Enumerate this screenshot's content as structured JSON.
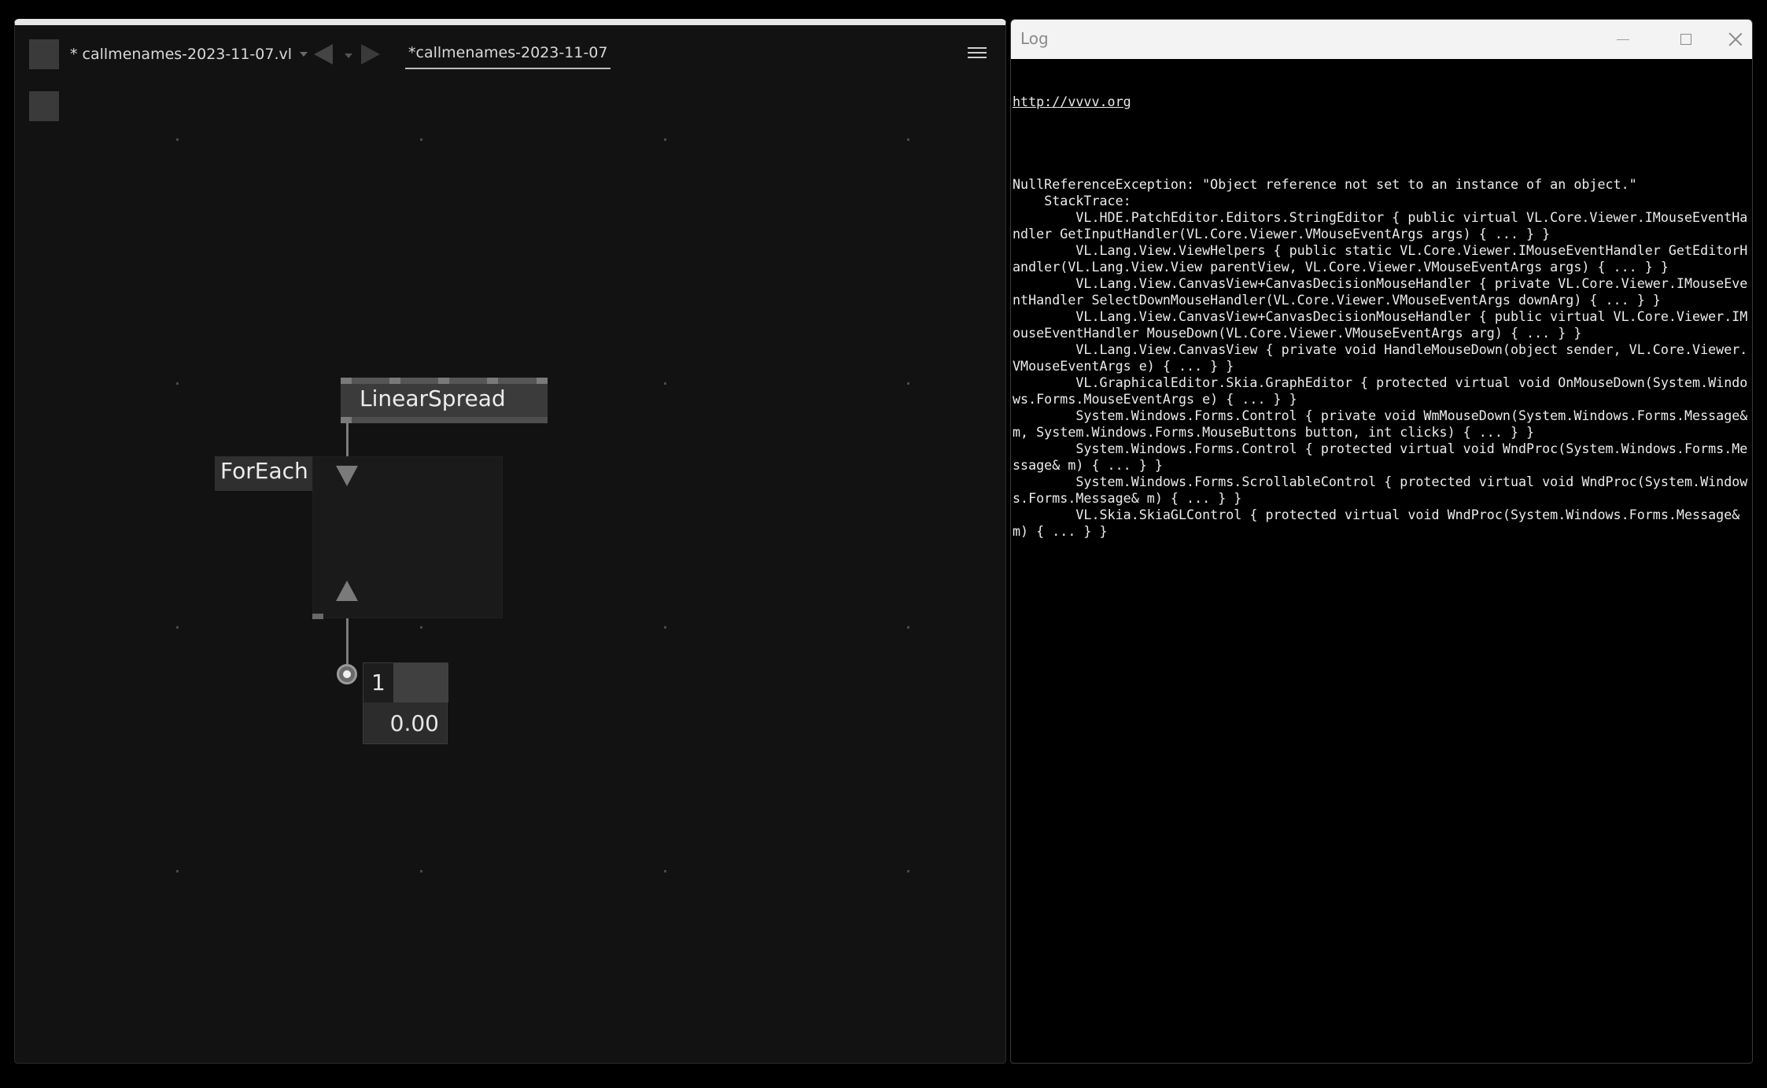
{
  "editor": {
    "document_dropdown": "* callmenames-2023-11-07.vl",
    "active_tab": "*callmenames-2023-11-07",
    "menu_icon": "hamburger-icon",
    "nodes": {
      "linearspread": "LinearSpread",
      "foreach": "ForEach",
      "iobox_count": "1",
      "iobox_value": "0.00"
    }
  },
  "log": {
    "title": "Log",
    "link": "http://vvvv.org",
    "text": "NullReferenceException: \"Object reference not set to an instance of an object.\"\n    StackTrace:\n        VL.HDE.PatchEditor.Editors.StringEditor { public virtual VL.Core.Viewer.IMouseEventHandler GetInputHandler(VL.Core.Viewer.VMouseEventArgs args) { ... } }\n        VL.Lang.View.ViewHelpers { public static VL.Core.Viewer.IMouseEventHandler GetEditorHandler(VL.Lang.View.View parentView, VL.Core.Viewer.VMouseEventArgs args) { ... } }\n        VL.Lang.View.CanvasView+CanvasDecisionMouseHandler { private VL.Core.Viewer.IMouseEventHandler SelectDownMouseHandler(VL.Core.Viewer.VMouseEventArgs downArg) { ... } }\n        VL.Lang.View.CanvasView+CanvasDecisionMouseHandler { public virtual VL.Core.Viewer.IMouseEventHandler MouseDown(VL.Core.Viewer.VMouseEventArgs arg) { ... } }\n        VL.Lang.View.CanvasView { private void HandleMouseDown(object sender, VL.Core.Viewer.VMouseEventArgs e) { ... } }\n        VL.GraphicalEditor.Skia.GraphEditor { protected virtual void OnMouseDown(System.Windows.Forms.MouseEventArgs e) { ... } }\n        System.Windows.Forms.Control { private void WmMouseDown(System.Windows.Forms.Message& m, System.Windows.Forms.MouseButtons button, int clicks) { ... } }\n        System.Windows.Forms.Control { protected virtual void WndProc(System.Windows.Forms.Message& m) { ... } }\n        System.Windows.Forms.ScrollableControl { protected virtual void WndProc(System.Windows.Forms.Message& m) { ... } }\n        VL.Skia.SkiaGLControl { protected virtual void WndProc(System.Windows.Forms.Message& m) { ... } }"
  },
  "colors": {
    "editor_background": "#121212",
    "node_fill": "#3b3b3b",
    "log_background": "#000000",
    "titlebar": "#f3f3f3"
  }
}
